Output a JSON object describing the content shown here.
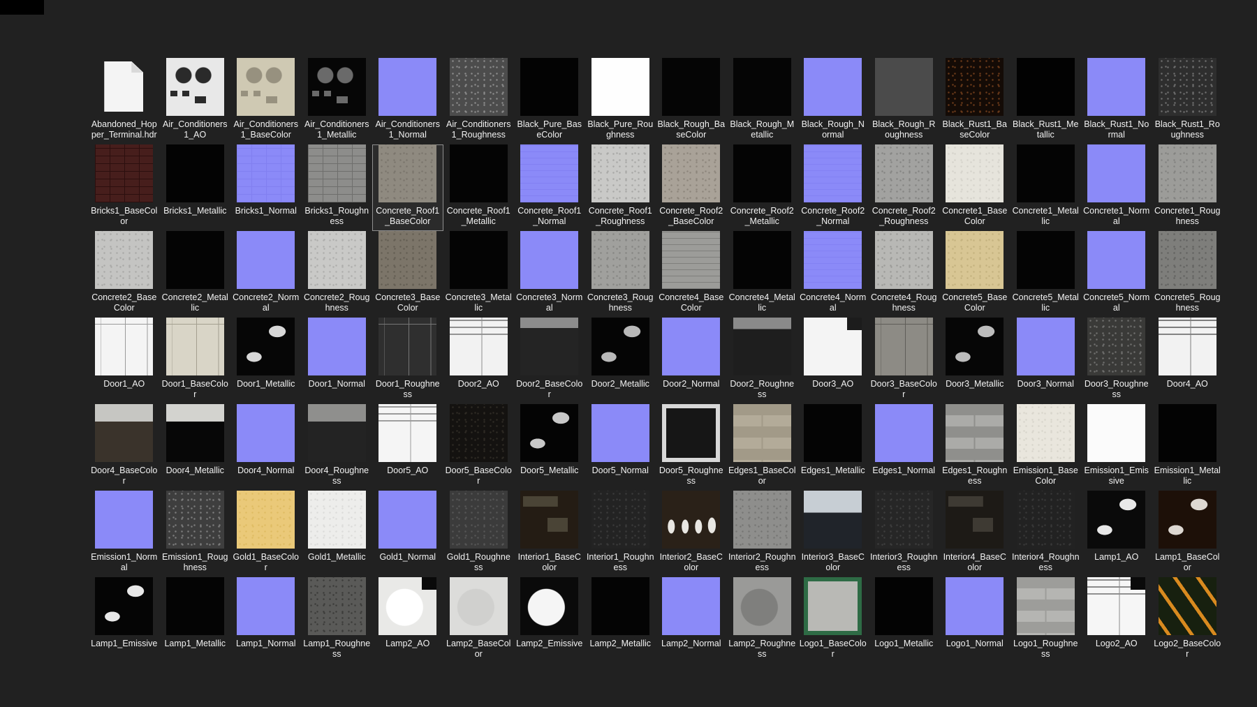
{
  "app": {
    "background": "#212121",
    "label_color": "#f2f2f2",
    "normal_map_color": "#8b8af8",
    "selection": {
      "item": "Concrete_Roof1_BaseColor",
      "border": "#8f8f8f",
      "fill": "#2b2b2b"
    }
  },
  "top_left_patch": {
    "color": "#000000"
  },
  "grid": {
    "columns": 16,
    "rows": 7,
    "items": [
      {
        "name": "Abandoned_Hopper_Terminal.hdr",
        "thumb": {
          "pattern": "page",
          "base": "#f4f4f4",
          "detail": "#d9d9d9"
        }
      },
      {
        "name": "Air_Conditioners1_AO",
        "thumb": {
          "pattern": "mech",
          "base": "#e8e8e8",
          "detail": "#2a2a2a"
        }
      },
      {
        "name": "Air_Conditioners1_BaseColor",
        "thumb": {
          "pattern": "mech",
          "base": "#cfc9b3",
          "detail": "#97917f"
        }
      },
      {
        "name": "Air_Conditioners1_Metallic",
        "thumb": {
          "pattern": "mech",
          "base": "#060606",
          "detail": "#6a6a6a"
        }
      },
      {
        "name": "Air_Conditioners1_Normal",
        "thumb": {
          "pattern": "solid",
          "base": "#8b8af8"
        }
      },
      {
        "name": "Air_Conditioners1_Roughness",
        "thumb": {
          "pattern": "noise",
          "base": "#4c4c4c",
          "detail": "#8b8b8b"
        }
      },
      {
        "name": "Black_Pure_BaseColor",
        "thumb": {
          "pattern": "solid",
          "base": "#030303"
        }
      },
      {
        "name": "Black_Pure_Roughness",
        "thumb": {
          "pattern": "solid",
          "base": "#fefefe"
        }
      },
      {
        "name": "Black_Rough_BaseColor",
        "thumb": {
          "pattern": "solid",
          "base": "#050505"
        }
      },
      {
        "name": "Black_Rough_Metallic",
        "thumb": {
          "pattern": "solid",
          "base": "#050505"
        }
      },
      {
        "name": "Black_Rough_Normal",
        "thumb": {
          "pattern": "solid",
          "base": "#8b8af8"
        }
      },
      {
        "name": "Black_Rough_Roughness",
        "thumb": {
          "pattern": "solid",
          "base": "#4b4b4b"
        }
      },
      {
        "name": "Black_Rust1_BaseColor",
        "thumb": {
          "pattern": "noise",
          "base": "#140b06",
          "detail": "#6b3a1a"
        }
      },
      {
        "name": "Black_Rust1_Metallic",
        "thumb": {
          "pattern": "solid",
          "base": "#020202"
        }
      },
      {
        "name": "Black_Rust1_Normal",
        "thumb": {
          "pattern": "solid",
          "base": "#8b8af8"
        }
      },
      {
        "name": "Black_Rust1_Roughness",
        "thumb": {
          "pattern": "noise",
          "base": "#2e2e2e",
          "detail": "#6e6e6e"
        }
      },
      {
        "name": "Bricks1_BaseColor",
        "thumb": {
          "pattern": "grid",
          "base": "#471e1c",
          "detail": "#2c0f0e"
        }
      },
      {
        "name": "Bricks1_Metallic",
        "thumb": {
          "pattern": "solid",
          "base": "#030303"
        }
      },
      {
        "name": "Bricks1_Normal",
        "thumb": {
          "pattern": "grid",
          "base": "#8b8af8",
          "detail": "#817ff0"
        }
      },
      {
        "name": "Bricks1_Roughness",
        "thumb": {
          "pattern": "grid",
          "base": "#8d8d8b",
          "detail": "#6e6e6c"
        }
      },
      {
        "name": "Concrete_Roof1_BaseColor",
        "selected": true,
        "thumb": {
          "pattern": "noise",
          "base": "#8f8a80",
          "detail": "#7a756c"
        }
      },
      {
        "name": "Concrete_Roof1_Metallic",
        "thumb": {
          "pattern": "solid",
          "base": "#040404"
        }
      },
      {
        "name": "Concrete_Roof1_Normal",
        "thumb": {
          "pattern": "hlines",
          "base": "#8b8af8",
          "detail": "#8280f2"
        }
      },
      {
        "name": "Concrete_Roof1_Roughness",
        "thumb": {
          "pattern": "noise",
          "base": "#c9c9c7",
          "detail": "#a8a8a6"
        }
      },
      {
        "name": "Concrete_Roof2_BaseColor",
        "thumb": {
          "pattern": "noise",
          "base": "#a9a298",
          "detail": "#8d867c"
        }
      },
      {
        "name": "Concrete_Roof2_Metallic",
        "thumb": {
          "pattern": "solid",
          "base": "#040404"
        }
      },
      {
        "name": "Concrete_Roof2_Normal",
        "thumb": {
          "pattern": "hlines",
          "base": "#8b8af8",
          "detail": "#8381f3"
        }
      },
      {
        "name": "Concrete_Roof2_Roughness",
        "thumb": {
          "pattern": "noise",
          "base": "#a2a2a0",
          "detail": "#858583"
        }
      },
      {
        "name": "Concrete1_BaseColor",
        "thumb": {
          "pattern": "noise",
          "base": "#e6e4dc",
          "detail": "#d5d3cb"
        }
      },
      {
        "name": "Concrete1_Metallic",
        "thumb": {
          "pattern": "solid",
          "base": "#040404"
        }
      },
      {
        "name": "Concrete1_Normal",
        "thumb": {
          "pattern": "solid",
          "base": "#8b8af8"
        }
      },
      {
        "name": "Concrete1_Roughness",
        "thumb": {
          "pattern": "noise",
          "base": "#9c9c99",
          "detail": "#828280"
        }
      },
      {
        "name": "Concrete2_BaseColor",
        "thumb": {
          "pattern": "noise",
          "base": "#c4c4c2",
          "detail": "#a9a9a7"
        }
      },
      {
        "name": "Concrete2_Metallic",
        "thumb": {
          "pattern": "solid",
          "base": "#040404"
        }
      },
      {
        "name": "Concrete2_Normal",
        "thumb": {
          "pattern": "solid",
          "base": "#8b8af8"
        }
      },
      {
        "name": "Concrete2_Roughness",
        "thumb": {
          "pattern": "noise",
          "base": "#c9c9c7",
          "detail": "#aeaeac"
        }
      },
      {
        "name": "Concrete3_BaseColor",
        "thumb": {
          "pattern": "noise",
          "base": "#7c7569",
          "detail": "#645e53"
        }
      },
      {
        "name": "Concrete3_Metallic",
        "thumb": {
          "pattern": "solid",
          "base": "#040404"
        }
      },
      {
        "name": "Concrete3_Normal",
        "thumb": {
          "pattern": "solid",
          "base": "#8b8af8"
        }
      },
      {
        "name": "Concrete3_Roughness",
        "thumb": {
          "pattern": "noise",
          "base": "#a0a09d",
          "detail": "#868683"
        }
      },
      {
        "name": "Concrete4_BaseColor",
        "thumb": {
          "pattern": "hlines",
          "base": "#9c9c99",
          "detail": "#7f7f7c"
        }
      },
      {
        "name": "Concrete4_Metallic",
        "thumb": {
          "pattern": "solid",
          "base": "#040404"
        }
      },
      {
        "name": "Concrete4_Normal",
        "thumb": {
          "pattern": "hlines",
          "base": "#8b8af8",
          "detail": "#8381f3"
        }
      },
      {
        "name": "Concrete4_Roughness",
        "thumb": {
          "pattern": "noise",
          "base": "#b8b8b5",
          "detail": "#9b9b98"
        }
      },
      {
        "name": "Concrete5_BaseColor",
        "thumb": {
          "pattern": "noise",
          "base": "#d8c694",
          "detail": "#c4b27f"
        }
      },
      {
        "name": "Concrete5_Metallic",
        "thumb": {
          "pattern": "solid",
          "base": "#040404"
        }
      },
      {
        "name": "Concrete5_Normal",
        "thumb": {
          "pattern": "solid",
          "base": "#8b8af8"
        }
      },
      {
        "name": "Concrete5_Roughness",
        "thumb": {
          "pattern": "noise",
          "base": "#7e7e7b",
          "detail": "#636360"
        }
      },
      {
        "name": "Door1_AO",
        "thumb": {
          "pattern": "door",
          "base": "#f4f4f4",
          "detail": "#9a9a9a"
        }
      },
      {
        "name": "Door1_BaseColor",
        "thumb": {
          "pattern": "door",
          "base": "#d9d5c7",
          "detail": "#a49f90"
        }
      },
      {
        "name": "Door1_Metallic",
        "thumb": {
          "pattern": "blobs",
          "base": "#060606",
          "detail": "#d8d8d8"
        }
      },
      {
        "name": "Door1_Normal",
        "thumb": {
          "pattern": "solid",
          "base": "#8b8af8"
        }
      },
      {
        "name": "Door1_Roughness",
        "thumb": {
          "pattern": "door",
          "base": "#2f2f2f",
          "detail": "#777777"
        }
      },
      {
        "name": "Door2_AO",
        "thumb": {
          "pattern": "panels",
          "base": "#f2f2f2",
          "detail": "#8f8f8f"
        }
      },
      {
        "name": "Door2_BaseColor",
        "thumb": {
          "pattern": "split",
          "base": "#242424",
          "detail": "#8c8c8c",
          "split": "18%"
        }
      },
      {
        "name": "Door2_Metallic",
        "thumb": {
          "pattern": "blobs",
          "base": "#050505",
          "detail": "#b9b9b9"
        }
      },
      {
        "name": "Door2_Normal",
        "thumb": {
          "pattern": "solid",
          "base": "#8b8af8"
        }
      },
      {
        "name": "Door2_Roughness",
        "thumb": {
          "pattern": "split",
          "base": "#1e1e1e",
          "detail": "#8a8a8a",
          "split": "20%"
        }
      },
      {
        "name": "Door3_AO",
        "thumb": {
          "pattern": "solid",
          "base": "#f4f4f4",
          "corner": "#1c1c1c"
        }
      },
      {
        "name": "Door3_BaseColor",
        "thumb": {
          "pattern": "door",
          "base": "#8d8b85",
          "detail": "#5f5d58"
        }
      },
      {
        "name": "Door3_Metallic",
        "thumb": {
          "pattern": "blobs",
          "base": "#060606",
          "detail": "#bcbcbc"
        }
      },
      {
        "name": "Door3_Normal",
        "thumb": {
          "pattern": "solid",
          "base": "#8b8af8"
        }
      },
      {
        "name": "Door3_Roughness",
        "thumb": {
          "pattern": "noise",
          "base": "#3a3a38",
          "detail": "#6f6f6d"
        }
      },
      {
        "name": "Door4_AO",
        "thumb": {
          "pattern": "panels",
          "base": "#f2f2f2",
          "detail": "#7d7d7d"
        }
      },
      {
        "name": "Door4_BaseColor",
        "thumb": {
          "pattern": "split",
          "base": "#3a332b",
          "detail": "#c6c6c2",
          "split": "30%"
        }
      },
      {
        "name": "Door4_Metallic",
        "thumb": {
          "pattern": "split",
          "base": "#070707",
          "detail": "#d3d3cf",
          "split": "30%"
        }
      },
      {
        "name": "Door4_Normal",
        "thumb": {
          "pattern": "solid",
          "base": "#8b8af8"
        }
      },
      {
        "name": "Door4_Roughness",
        "thumb": {
          "pattern": "split",
          "base": "#232323",
          "detail": "#8f8f8d",
          "split": "30%"
        }
      },
      {
        "name": "Door5_AO",
        "thumb": {
          "pattern": "panels",
          "base": "#f5f5f5",
          "detail": "#9a9a9a"
        }
      },
      {
        "name": "Door5_BaseColor",
        "thumb": {
          "pattern": "noise",
          "base": "#141210",
          "detail": "#2e2a24"
        }
      },
      {
        "name": "Door5_Metallic",
        "thumb": {
          "pattern": "blobs",
          "base": "#040404",
          "detail": "#c8c8c8"
        }
      },
      {
        "name": "Door5_Normal",
        "thumb": {
          "pattern": "solid",
          "base": "#8b8af8"
        }
      },
      {
        "name": "Door5_Roughness",
        "thumb": {
          "pattern": "frame",
          "base": "#161616",
          "detail": "#d8d8d8"
        }
      },
      {
        "name": "Edges1_BaseColor",
        "thumb": {
          "pattern": "bands",
          "base": "#b3ab99",
          "detail": "#a29a88"
        }
      },
      {
        "name": "Edges1_Metallic",
        "thumb": {
          "pattern": "solid",
          "base": "#040404"
        }
      },
      {
        "name": "Edges1_Normal",
        "thumb": {
          "pattern": "solid",
          "base": "#8b8af8"
        }
      },
      {
        "name": "Edges1_Roughness",
        "thumb": {
          "pattern": "bands",
          "base": "#ababa8",
          "detail": "#8f8f8c"
        }
      },
      {
        "name": "Emission1_BaseColor",
        "thumb": {
          "pattern": "noise",
          "base": "#e9e6dd",
          "detail": "#d8d5cc"
        }
      },
      {
        "name": "Emission1_Emissive",
        "thumb": {
          "pattern": "solid",
          "base": "#fbfbfb"
        }
      },
      {
        "name": "Emission1_Metallic",
        "thumb": {
          "pattern": "solid",
          "base": "#030303"
        }
      },
      {
        "name": "Emission1_Normal",
        "thumb": {
          "pattern": "solid",
          "base": "#8b8af8"
        }
      },
      {
        "name": "Emission1_Roughness",
        "thumb": {
          "pattern": "noise",
          "base": "#3e3e3e",
          "detail": "#7c7c7c"
        }
      },
      {
        "name": "Gold1_BaseColor",
        "thumb": {
          "pattern": "noise",
          "base": "#eac979",
          "detail": "#dfbc63"
        }
      },
      {
        "name": "Gold1_Metallic",
        "thumb": {
          "pattern": "noise",
          "base": "#ededeb",
          "detail": "#dcdcda"
        }
      },
      {
        "name": "Gold1_Normal",
        "thumb": {
          "pattern": "solid",
          "base": "#8b8af8"
        }
      },
      {
        "name": "Gold1_Roughness",
        "thumb": {
          "pattern": "noise",
          "base": "#3b3b3b",
          "detail": "#565656"
        }
      },
      {
        "name": "Interior1_BaseColor",
        "thumb": {
          "pattern": "photo",
          "base": "#241c14",
          "detail": "#4a4436",
          "accent": "#6b5a3c"
        }
      },
      {
        "name": "Interior1_Roughness",
        "thumb": {
          "pattern": "noise",
          "base": "#232323",
          "detail": "#3a3a3a"
        }
      },
      {
        "name": "Interior2_BaseColor",
        "thumb": {
          "pattern": "dresses",
          "base": "#2a2118",
          "detail": "#e9e7e2"
        }
      },
      {
        "name": "Interior2_Roughness",
        "thumb": {
          "pattern": "noise",
          "base": "#8e8e8c",
          "detail": "#767674"
        }
      },
      {
        "name": "Interior3_BaseColor",
        "thumb": {
          "pattern": "split",
          "base": "#20242a",
          "detail": "#c7ced4",
          "split": "38%"
        }
      },
      {
        "name": "Interior3_Roughness",
        "thumb": {
          "pattern": "noise",
          "base": "#262626",
          "detail": "#3d3d3d"
        }
      },
      {
        "name": "Interior4_BaseColor",
        "thumb": {
          "pattern": "photo",
          "base": "#1d1a16",
          "detail": "#3e3a33",
          "accent": "#7a4a2a"
        }
      },
      {
        "name": "Interior4_Roughness",
        "thumb": {
          "pattern": "noise",
          "base": "#222222",
          "detail": "#383838"
        }
      },
      {
        "name": "Lamp1_AO",
        "thumb": {
          "pattern": "blobs",
          "base": "#0a0a0a",
          "detail": "#e8e8e8"
        }
      },
      {
        "name": "Lamp1_BaseColor",
        "thumb": {
          "pattern": "blobs",
          "base": "#1d1008",
          "detail": "#ddd8d2"
        }
      },
      {
        "name": "Lamp1_Emissive",
        "thumb": {
          "pattern": "blobs",
          "base": "#050505",
          "detail": "#e8e8e8"
        }
      },
      {
        "name": "Lamp1_Metallic",
        "thumb": {
          "pattern": "solid",
          "base": "#040404"
        }
      },
      {
        "name": "Lamp1_Normal",
        "thumb": {
          "pattern": "solid",
          "base": "#8b8af8"
        }
      },
      {
        "name": "Lamp1_Roughness",
        "thumb": {
          "pattern": "noise",
          "base": "#5a5a58",
          "detail": "#3c3c3a"
        }
      },
      {
        "name": "Lamp2_AO",
        "thumb": {
          "pattern": "circle",
          "base": "#e9e9e7",
          "detail": "#ffffff",
          "corner": "#0a0a0a"
        }
      },
      {
        "name": "Lamp2_BaseColor",
        "thumb": {
          "pattern": "circle",
          "base": "#dcdcda",
          "detail": "#d0d0ce"
        }
      },
      {
        "name": "Lamp2_Emissive",
        "thumb": {
          "pattern": "circle",
          "base": "#0a0a0a",
          "detail": "#f5f5f5"
        }
      },
      {
        "name": "Lamp2_Metallic",
        "thumb": {
          "pattern": "solid",
          "base": "#040404"
        }
      },
      {
        "name": "Lamp2_Normal",
        "thumb": {
          "pattern": "solid",
          "base": "#8b8af8"
        }
      },
      {
        "name": "Lamp2_Roughness",
        "thumb": {
          "pattern": "circle",
          "base": "#9a9a98",
          "detail": "#7f7f7d"
        }
      },
      {
        "name": "Logo1_BaseColor",
        "thumb": {
          "pattern": "frame",
          "base": "#b9b9b5",
          "detail": "#2e6b45"
        }
      },
      {
        "name": "Logo1_Metallic",
        "thumb": {
          "pattern": "solid",
          "base": "#030303"
        }
      },
      {
        "name": "Logo1_Normal",
        "thumb": {
          "pattern": "solid",
          "base": "#8b8af8"
        }
      },
      {
        "name": "Logo1_Roughness",
        "thumb": {
          "pattern": "bands",
          "base": "#b5b5b2",
          "detail": "#9d9d9a"
        }
      },
      {
        "name": "Logo2_AO",
        "thumb": {
          "pattern": "panels",
          "base": "#f6f6f6",
          "detail": "#8a8a8a",
          "corner": "#0a0a0a"
        }
      },
      {
        "name": "Logo2_BaseColor",
        "thumb": {
          "pattern": "diag",
          "base": "#17200f",
          "detail": "#d98a1f"
        }
      }
    ]
  }
}
